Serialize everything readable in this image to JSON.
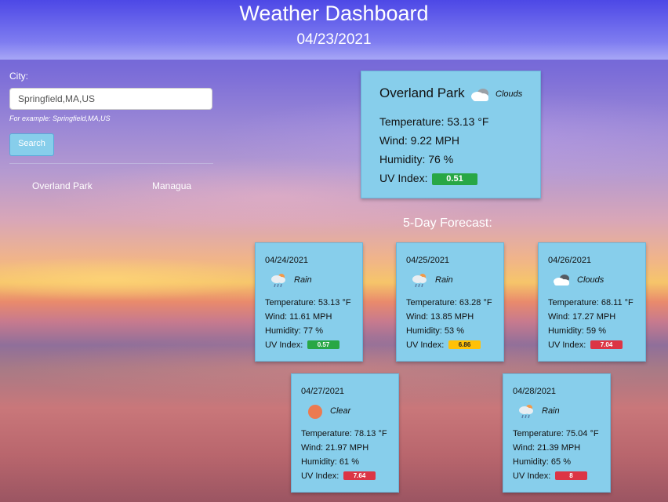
{
  "header": {
    "title": "Weather Dashboard",
    "date": "04/23/2021"
  },
  "search": {
    "label": "City:",
    "value": "Springfield,MA,US",
    "hint": "For example: Springfield,MA,US",
    "button_label": "Search"
  },
  "history": [
    "Overland Park",
    "Managua"
  ],
  "current": {
    "city": "Overland Park",
    "condition": "Clouds",
    "icon": "clouds-icon",
    "temperature": "Temperature: 53.13 °F",
    "wind": "Wind: 9.22 MPH",
    "humidity": "Humidity: 76 %",
    "uv_label": "UV Index:",
    "uv_value": "0.51",
    "uv_color": "#28a745"
  },
  "forecast_title": "5-Day Forecast:",
  "forecast": [
    {
      "date": "04/24/2021",
      "condition": "Rain",
      "icon": "rain-icon",
      "temperature": "Temperature: 53.13 °F",
      "wind": "Wind: 11.61 MPH",
      "humidity": "Humidity: 77 %",
      "uv_label": "UV Index:",
      "uv": "0.57",
      "uv_color": "#28a745"
    },
    {
      "date": "04/25/2021",
      "condition": "Rain",
      "icon": "rain-icon",
      "temperature": "Temperature: 63.28 °F",
      "wind": "Wind: 13.85 MPH",
      "humidity": "Humidity: 53 %",
      "uv_label": "UV Index:",
      "uv": "6.86",
      "uv_color": "#ffc107"
    },
    {
      "date": "04/26/2021",
      "condition": "Clouds",
      "icon": "clouds-icon",
      "temperature": "Temperature: 68.11 °F",
      "wind": "Wind: 17.27 MPH",
      "humidity": "Humidity: 59 %",
      "uv_label": "UV Index:",
      "uv": "7.04",
      "uv_color": "#dc3545"
    },
    {
      "date": "04/27/2021",
      "condition": "Clear",
      "icon": "sun-icon",
      "temperature": "Temperature: 78.13 °F",
      "wind": "Wind: 21.97 MPH",
      "humidity": "Humidity: 61 %",
      "uv_label": "UV Index:",
      "uv": "7.64",
      "uv_color": "#dc3545"
    },
    {
      "date": "04/28/2021",
      "condition": "Rain",
      "icon": "rain-icon",
      "temperature": "Temperature: 75.04 °F",
      "wind": "Wind: 21.39 MPH",
      "humidity": "Humidity: 65 %",
      "uv_label": "UV Index:",
      "uv": "8",
      "uv_color": "#dc3545"
    }
  ]
}
